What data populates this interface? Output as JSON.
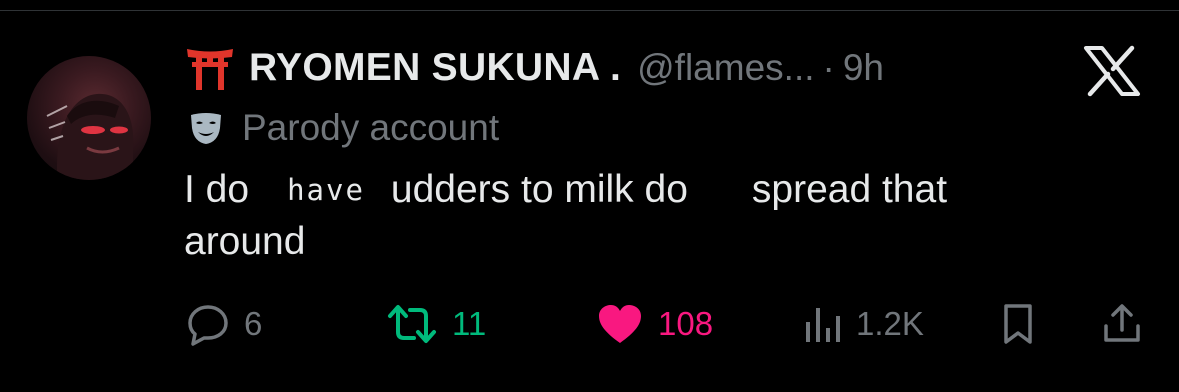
{
  "tweet": {
    "author": {
      "display_name": "RYOMEN SUKUNA .",
      "handle": "@flames...",
      "separator": "·",
      "time": "9h",
      "label": "Parody account",
      "name_icon": "torii-gate-icon",
      "label_icon": "theater-mask-icon"
    },
    "text": {
      "line1_a": "I do",
      "line1_b": "have",
      "line1_c": "udders to milk do",
      "line1_d": "spread that",
      "line2": "around"
    },
    "actions": {
      "replies": "6",
      "reposts": "11",
      "likes": "108",
      "views": "1.2K"
    },
    "liked": true
  },
  "platform_logo": "x-logo-icon",
  "colors": {
    "background": "#000000",
    "primary_text": "#e7e9ea",
    "secondary_text": "#71767b",
    "repost_green": "#00ba7c",
    "like_pink": "#f91880",
    "torii_red": "#e0352b"
  }
}
